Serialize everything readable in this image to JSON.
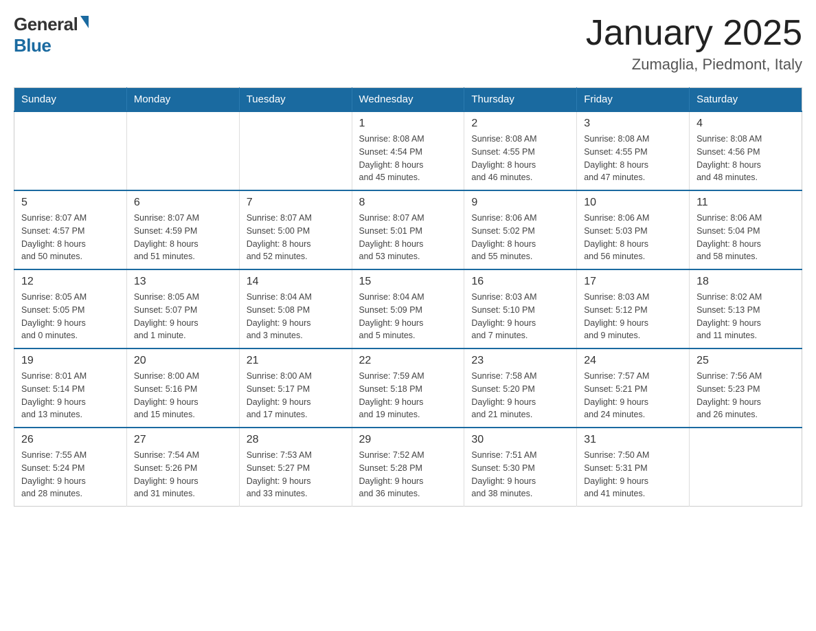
{
  "header": {
    "logo": {
      "general": "General",
      "blue": "Blue"
    },
    "title": "January 2025",
    "location": "Zumaglia, Piedmont, Italy"
  },
  "days_of_week": [
    "Sunday",
    "Monday",
    "Tuesday",
    "Wednesday",
    "Thursday",
    "Friday",
    "Saturday"
  ],
  "weeks": [
    {
      "days": [
        {
          "number": "",
          "info": ""
        },
        {
          "number": "",
          "info": ""
        },
        {
          "number": "",
          "info": ""
        },
        {
          "number": "1",
          "info": "Sunrise: 8:08 AM\nSunset: 4:54 PM\nDaylight: 8 hours\nand 45 minutes."
        },
        {
          "number": "2",
          "info": "Sunrise: 8:08 AM\nSunset: 4:55 PM\nDaylight: 8 hours\nand 46 minutes."
        },
        {
          "number": "3",
          "info": "Sunrise: 8:08 AM\nSunset: 4:55 PM\nDaylight: 8 hours\nand 47 minutes."
        },
        {
          "number": "4",
          "info": "Sunrise: 8:08 AM\nSunset: 4:56 PM\nDaylight: 8 hours\nand 48 minutes."
        }
      ]
    },
    {
      "days": [
        {
          "number": "5",
          "info": "Sunrise: 8:07 AM\nSunset: 4:57 PM\nDaylight: 8 hours\nand 50 minutes."
        },
        {
          "number": "6",
          "info": "Sunrise: 8:07 AM\nSunset: 4:59 PM\nDaylight: 8 hours\nand 51 minutes."
        },
        {
          "number": "7",
          "info": "Sunrise: 8:07 AM\nSunset: 5:00 PM\nDaylight: 8 hours\nand 52 minutes."
        },
        {
          "number": "8",
          "info": "Sunrise: 8:07 AM\nSunset: 5:01 PM\nDaylight: 8 hours\nand 53 minutes."
        },
        {
          "number": "9",
          "info": "Sunrise: 8:06 AM\nSunset: 5:02 PM\nDaylight: 8 hours\nand 55 minutes."
        },
        {
          "number": "10",
          "info": "Sunrise: 8:06 AM\nSunset: 5:03 PM\nDaylight: 8 hours\nand 56 minutes."
        },
        {
          "number": "11",
          "info": "Sunrise: 8:06 AM\nSunset: 5:04 PM\nDaylight: 8 hours\nand 58 minutes."
        }
      ]
    },
    {
      "days": [
        {
          "number": "12",
          "info": "Sunrise: 8:05 AM\nSunset: 5:05 PM\nDaylight: 9 hours\nand 0 minutes."
        },
        {
          "number": "13",
          "info": "Sunrise: 8:05 AM\nSunset: 5:07 PM\nDaylight: 9 hours\nand 1 minute."
        },
        {
          "number": "14",
          "info": "Sunrise: 8:04 AM\nSunset: 5:08 PM\nDaylight: 9 hours\nand 3 minutes."
        },
        {
          "number": "15",
          "info": "Sunrise: 8:04 AM\nSunset: 5:09 PM\nDaylight: 9 hours\nand 5 minutes."
        },
        {
          "number": "16",
          "info": "Sunrise: 8:03 AM\nSunset: 5:10 PM\nDaylight: 9 hours\nand 7 minutes."
        },
        {
          "number": "17",
          "info": "Sunrise: 8:03 AM\nSunset: 5:12 PM\nDaylight: 9 hours\nand 9 minutes."
        },
        {
          "number": "18",
          "info": "Sunrise: 8:02 AM\nSunset: 5:13 PM\nDaylight: 9 hours\nand 11 minutes."
        }
      ]
    },
    {
      "days": [
        {
          "number": "19",
          "info": "Sunrise: 8:01 AM\nSunset: 5:14 PM\nDaylight: 9 hours\nand 13 minutes."
        },
        {
          "number": "20",
          "info": "Sunrise: 8:00 AM\nSunset: 5:16 PM\nDaylight: 9 hours\nand 15 minutes."
        },
        {
          "number": "21",
          "info": "Sunrise: 8:00 AM\nSunset: 5:17 PM\nDaylight: 9 hours\nand 17 minutes."
        },
        {
          "number": "22",
          "info": "Sunrise: 7:59 AM\nSunset: 5:18 PM\nDaylight: 9 hours\nand 19 minutes."
        },
        {
          "number": "23",
          "info": "Sunrise: 7:58 AM\nSunset: 5:20 PM\nDaylight: 9 hours\nand 21 minutes."
        },
        {
          "number": "24",
          "info": "Sunrise: 7:57 AM\nSunset: 5:21 PM\nDaylight: 9 hours\nand 24 minutes."
        },
        {
          "number": "25",
          "info": "Sunrise: 7:56 AM\nSunset: 5:23 PM\nDaylight: 9 hours\nand 26 minutes."
        }
      ]
    },
    {
      "days": [
        {
          "number": "26",
          "info": "Sunrise: 7:55 AM\nSunset: 5:24 PM\nDaylight: 9 hours\nand 28 minutes."
        },
        {
          "number": "27",
          "info": "Sunrise: 7:54 AM\nSunset: 5:26 PM\nDaylight: 9 hours\nand 31 minutes."
        },
        {
          "number": "28",
          "info": "Sunrise: 7:53 AM\nSunset: 5:27 PM\nDaylight: 9 hours\nand 33 minutes."
        },
        {
          "number": "29",
          "info": "Sunrise: 7:52 AM\nSunset: 5:28 PM\nDaylight: 9 hours\nand 36 minutes."
        },
        {
          "number": "30",
          "info": "Sunrise: 7:51 AM\nSunset: 5:30 PM\nDaylight: 9 hours\nand 38 minutes."
        },
        {
          "number": "31",
          "info": "Sunrise: 7:50 AM\nSunset: 5:31 PM\nDaylight: 9 hours\nand 41 minutes."
        },
        {
          "number": "",
          "info": ""
        }
      ]
    }
  ]
}
